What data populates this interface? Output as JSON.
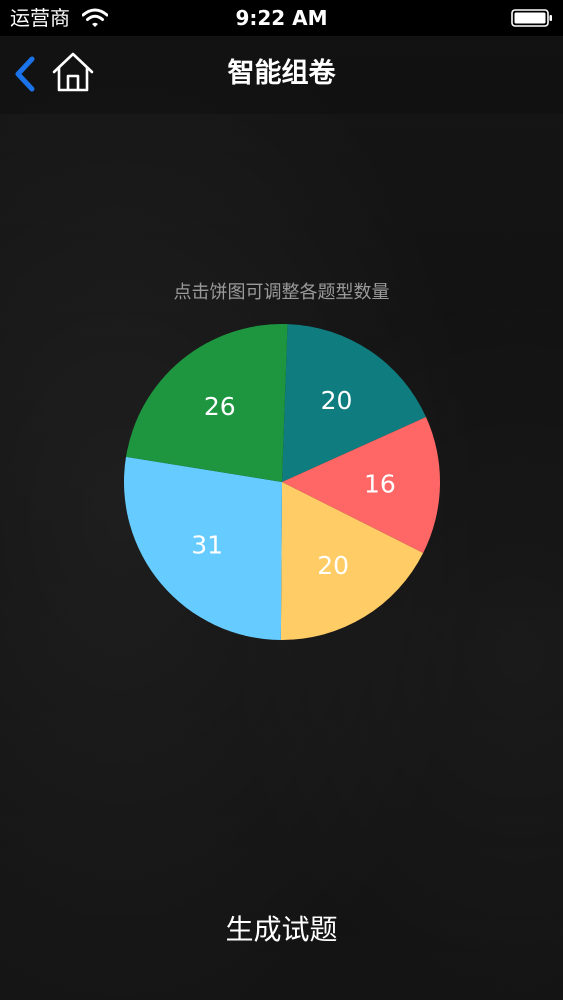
{
  "status_bar": {
    "carrier": "运营商",
    "time": "9:22 AM"
  },
  "nav": {
    "title": "智能组卷",
    "back_icon": "chevron-left-icon",
    "home_icon": "home-icon"
  },
  "hint": "点击饼图可调整各题型数量",
  "chart_data": {
    "type": "pie",
    "slices": [
      {
        "value": 20,
        "label": "20",
        "color": "#0f7d7f"
      },
      {
        "value": 16,
        "label": "16",
        "color": "#ff6666"
      },
      {
        "value": 20,
        "label": "20",
        "color": "#ffcc66"
      },
      {
        "value": 31,
        "label": "31",
        "color": "#66ccff"
      },
      {
        "value": 26,
        "label": "26",
        "color": "#1e9640"
      }
    ]
  },
  "actions": {
    "generate_label": "生成试题"
  },
  "colors": {
    "accent": "#1a73e8",
    "background": "#111111"
  }
}
